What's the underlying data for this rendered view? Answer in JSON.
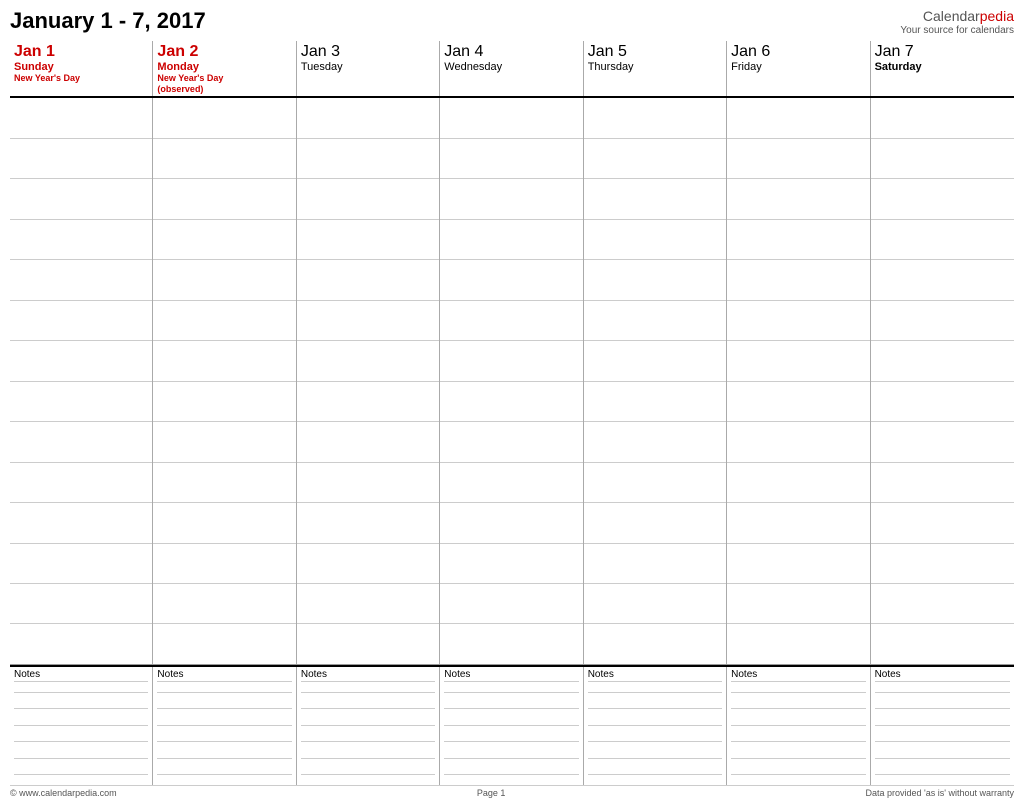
{
  "header": {
    "title": "January 1 - 7, 2017",
    "brand_name_prefix": "Calendar",
    "brand_name_suffix": "pedia",
    "brand_tagline": "Your source for calendars"
  },
  "days": [
    {
      "number": "Jan 1",
      "name": "Sunday",
      "red": true,
      "bold": false,
      "holiday": "New Year's Day"
    },
    {
      "number": "Jan 2",
      "name": "Monday",
      "red": true,
      "bold": false,
      "holiday": "New Year's Day\n(observed)"
    },
    {
      "number": "Jan 3",
      "name": "Tuesday",
      "red": false,
      "bold": false,
      "holiday": ""
    },
    {
      "number": "Jan 4",
      "name": "Wednesday",
      "red": false,
      "bold": false,
      "holiday": ""
    },
    {
      "number": "Jan 5",
      "name": "Thursday",
      "red": false,
      "bold": false,
      "holiday": ""
    },
    {
      "number": "Jan 6",
      "name": "Friday",
      "red": false,
      "bold": false,
      "holiday": ""
    },
    {
      "number": "Jan 7",
      "name": "Saturday",
      "red": false,
      "bold": true,
      "holiday": ""
    }
  ],
  "time_rows_count": 14,
  "notes": {
    "label": "Notes",
    "cells": [
      "Notes",
      "Notes",
      "Notes",
      "Notes",
      "Notes",
      "Notes",
      "Notes"
    ]
  },
  "footer": {
    "left": "© www.calendarpedia.com",
    "center": "Page 1",
    "right": "Data provided 'as is' without warranty"
  },
  "colors": {
    "red": "#cc0000",
    "black": "#000000",
    "gray_border": "#aaaaaa"
  }
}
